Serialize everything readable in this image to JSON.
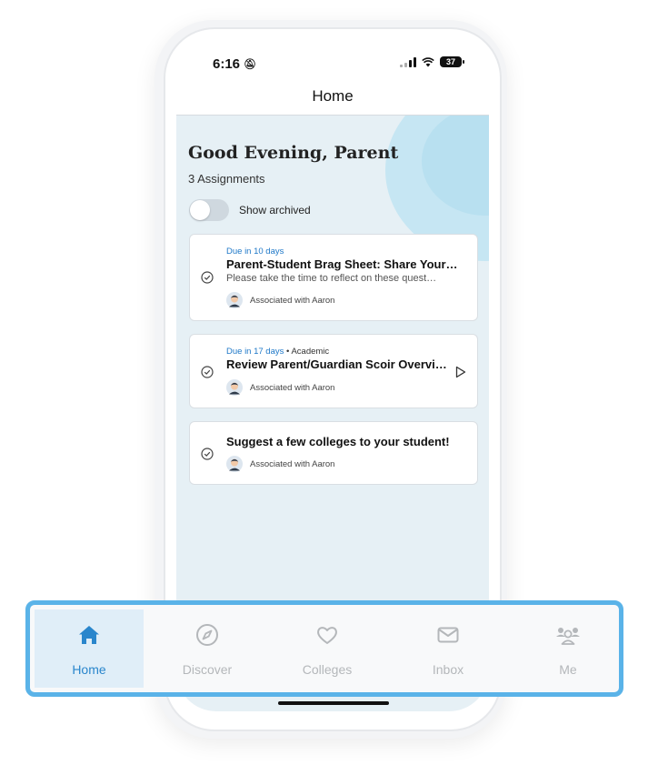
{
  "status_bar": {
    "time": "6:16",
    "battery": "37"
  },
  "nav": {
    "title": "Home"
  },
  "greeting": "Good Evening, Parent",
  "assignment_count": "3 Assignments",
  "archive_toggle": {
    "label": "Show archived",
    "on": false
  },
  "assignments": [
    {
      "due": "Due in 10 days",
      "category": "",
      "title": "Parent-Student Brag Sheet: Share Your…",
      "description": "Please take the time to reflect on these quest…",
      "associated": "Associated with Aaron"
    },
    {
      "due": "Due in 17 days",
      "category": " • Academic",
      "title": "Review Parent/Guardian Scoir Overvi…",
      "description": "",
      "associated": "Associated with Aaron"
    },
    {
      "due": "",
      "category": "",
      "title": "Suggest a few colleges to your student!",
      "description": "",
      "associated": "Associated with Aaron"
    }
  ],
  "tabbar": {
    "tabs": [
      {
        "label": "Home",
        "icon": "home-icon",
        "active": true
      },
      {
        "label": "Discover",
        "icon": "compass-icon",
        "active": false
      },
      {
        "label": "Colleges",
        "icon": "heart-icon",
        "active": false
      },
      {
        "label": "Inbox",
        "icon": "mail-icon",
        "active": false
      },
      {
        "label": "Me",
        "icon": "people-icon",
        "active": false
      }
    ]
  },
  "colors": {
    "accent": "#2a86cc",
    "highlight_border": "#5ab3e8",
    "background": "#e6f0f5",
    "inactive_tab": "#b4b7ba"
  }
}
